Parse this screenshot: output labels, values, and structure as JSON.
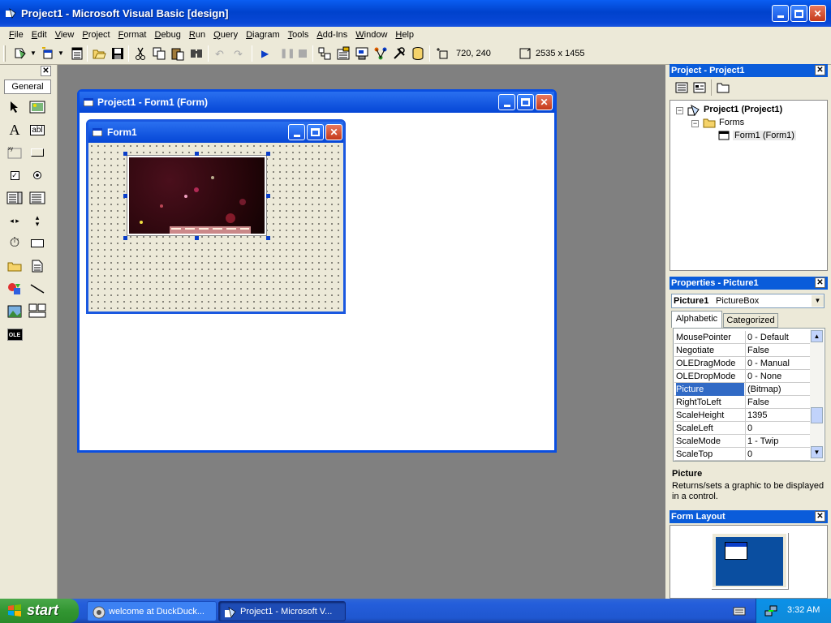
{
  "window": {
    "title": "Project1 - Microsoft Visual Basic [design]"
  },
  "menu": [
    "File",
    "Edit",
    "View",
    "Project",
    "Format",
    "Debug",
    "Run",
    "Query",
    "Diagram",
    "Tools",
    "Add-Ins",
    "Window",
    "Help"
  ],
  "toolbar": {
    "position": "720, 240",
    "size": "2535 x 1455"
  },
  "toolbox": {
    "tab": "General"
  },
  "designer": {
    "title": "Project1 - Form1 (Form)",
    "form_caption": "Form1"
  },
  "project_panel": {
    "title": "Project - Project1",
    "tree": {
      "root": "Project1 (Project1)",
      "folder": "Forms",
      "item": "Form1 (Form1)"
    }
  },
  "properties_panel": {
    "title": "Properties - Picture1",
    "object_name": "Picture1",
    "object_type": "PictureBox",
    "tabs": [
      "Alphabetic",
      "Categorized"
    ],
    "rows": [
      {
        "name": "MousePointer",
        "value": "0 - Default"
      },
      {
        "name": "Negotiate",
        "value": "False"
      },
      {
        "name": "OLEDragMode",
        "value": "0 - Manual"
      },
      {
        "name": "OLEDropMode",
        "value": "0 - None"
      },
      {
        "name": "Picture",
        "value": "(Bitmap)"
      },
      {
        "name": "RightToLeft",
        "value": "False"
      },
      {
        "name": "ScaleHeight",
        "value": "1395"
      },
      {
        "name": "ScaleLeft",
        "value": "0"
      },
      {
        "name": "ScaleMode",
        "value": "1 - Twip"
      },
      {
        "name": "ScaleTop",
        "value": "0"
      }
    ],
    "selected_row": "Picture",
    "desc_title": "Picture",
    "desc_text": "Returns/sets a graphic to be displayed in a control."
  },
  "layout_panel": {
    "title": "Form Layout"
  },
  "taskbar": {
    "start": "start",
    "tasks": [
      "welcome at DuckDuck...",
      "Project1 - Microsoft V..."
    ],
    "clock": "3:32 AM"
  },
  "colors": {
    "xp_blue": "#0a5cda",
    "selection": "#316ac5",
    "desktop_form": "#0a4ea0"
  }
}
